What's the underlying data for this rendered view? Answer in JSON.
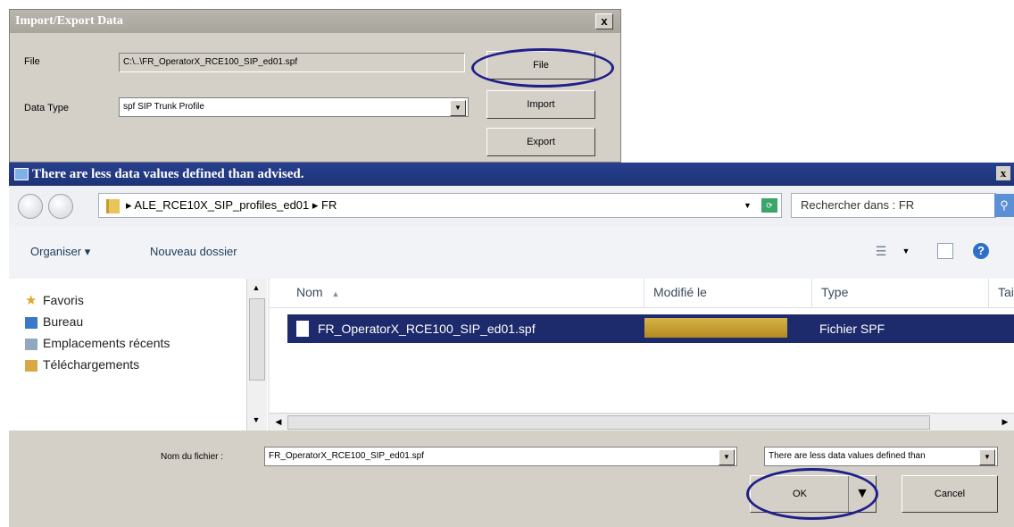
{
  "import_export": {
    "title": "Import/Export Data",
    "close_label": "x",
    "file_label": "File",
    "file_path": "C:\\..\\FR_OperatorX_RCE100_SIP_ed01.spf",
    "data_type_label": "Data Type",
    "data_type_value": "spf  SIP Trunk Profile",
    "file_button": "File",
    "import_button": "Import",
    "export_button": "Export"
  },
  "file_dialog": {
    "title": "There are less data values defined than advised.",
    "close_label": "x",
    "breadcrumb": "▸ ALE_RCE10X_SIP_profiles_ed01 ▸ FR",
    "search_placeholder": "Rechercher dans : FR",
    "toolbar": {
      "organize": "Organiser ▾",
      "new_folder": "Nouveau dossier"
    },
    "nav_items": [
      {
        "label": "Favoris"
      },
      {
        "label": "Bureau"
      },
      {
        "label": "Emplacements récents"
      },
      {
        "label": "Téléchargements"
      }
    ],
    "columns": {
      "name": "Nom",
      "modified": "Modifié le",
      "type": "Type",
      "size": "Taill"
    },
    "files": [
      {
        "name": "FR_OperatorX_RCE100_SIP_ed01.spf",
        "type": "Fichier SPF"
      }
    ],
    "filename_label": "Nom du fichier :",
    "filename_value": "FR_OperatorX_RCE100_SIP_ed01.spf",
    "filetype_value": "There are less data values defined than",
    "ok_button": "OK",
    "cancel_button": "Cancel"
  },
  "colors": {
    "title_active": "#1e3376",
    "selection": "#1d2a6b",
    "highlight_oval": "#1f1f8a"
  }
}
